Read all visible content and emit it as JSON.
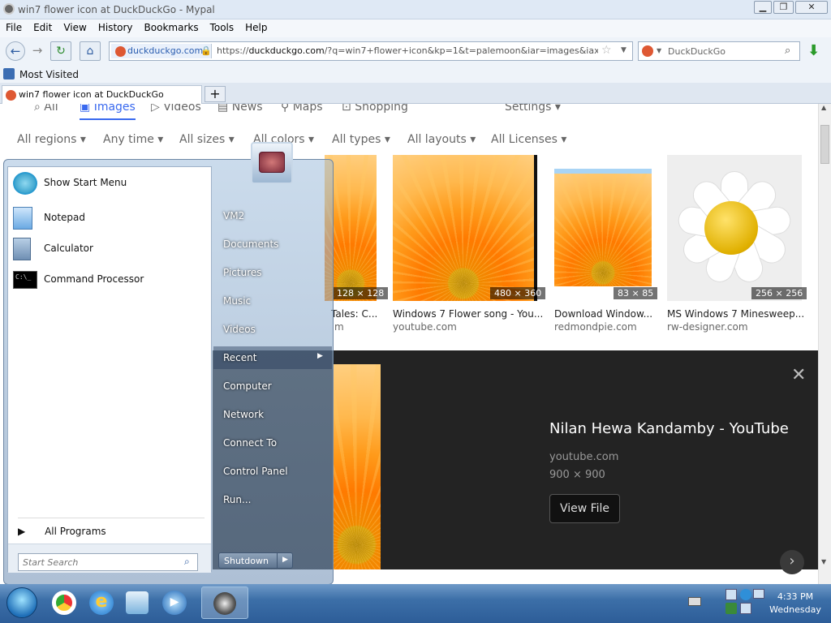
{
  "window": {
    "title": "win7 flower icon at DuckDuckGo - Mypal"
  },
  "menu": [
    "File",
    "Edit",
    "View",
    "History",
    "Bookmarks",
    "Tools",
    "Help"
  ],
  "nav": {
    "identity": "duckduckgo.com",
    "url_prefix": "https://",
    "url_domain": "duckduckgo.com",
    "url_rest": "/?q=win7+flower+icon&kp=1&t=palemoon&iar=images&iax=ima",
    "search_placeholder": "DuckDuckGo"
  },
  "bookmarks": {
    "most_visited": "Most Visited"
  },
  "tabs": {
    "active": "win7 flower icon at DuckDuckGo",
    "new_tab": "+"
  },
  "ddg": {
    "tabs": [
      "All",
      "Images",
      "Videos",
      "News",
      "Maps",
      "Shopping"
    ],
    "settings": "Settings",
    "filters": [
      "All regions",
      "Any time",
      "All sizes",
      "All colors",
      "All types",
      "All layouts",
      "All Licenses"
    ],
    "results": [
      {
        "badge": "128 × 128",
        "caption": "Tales: C...",
        "source": "m"
      },
      {
        "badge": "480 × 360",
        "caption": "Windows 7 Flower song - You...",
        "source": "youtube.com"
      },
      {
        "badge": "83 × 85",
        "caption": "Download Window...",
        "source": "redmondpie.com"
      },
      {
        "badge": "256 × 256",
        "caption": "MS Windows 7 Minesweep...",
        "source": "rw-designer.com"
      }
    ],
    "preview": {
      "title": "Nilan Hewa Kandamby - YouTube",
      "source": "youtube.com",
      "size": "900 × 900",
      "button": "View File"
    }
  },
  "startmenu": {
    "pinned": [
      "Show Start Menu",
      "Notepad",
      "Calculator",
      "Command Processor"
    ],
    "all_programs": "All Programs",
    "search_placeholder": "Start Search",
    "right": [
      "VM2",
      "Documents",
      "Pictures",
      "Music",
      "Videos",
      "Recent",
      "Computer",
      "Network",
      "Connect To",
      "Control Panel",
      "Run..."
    ],
    "shutdown": "Shutdown"
  },
  "taskbar": {
    "time": "4:33 PM",
    "day": "Wednesday"
  }
}
